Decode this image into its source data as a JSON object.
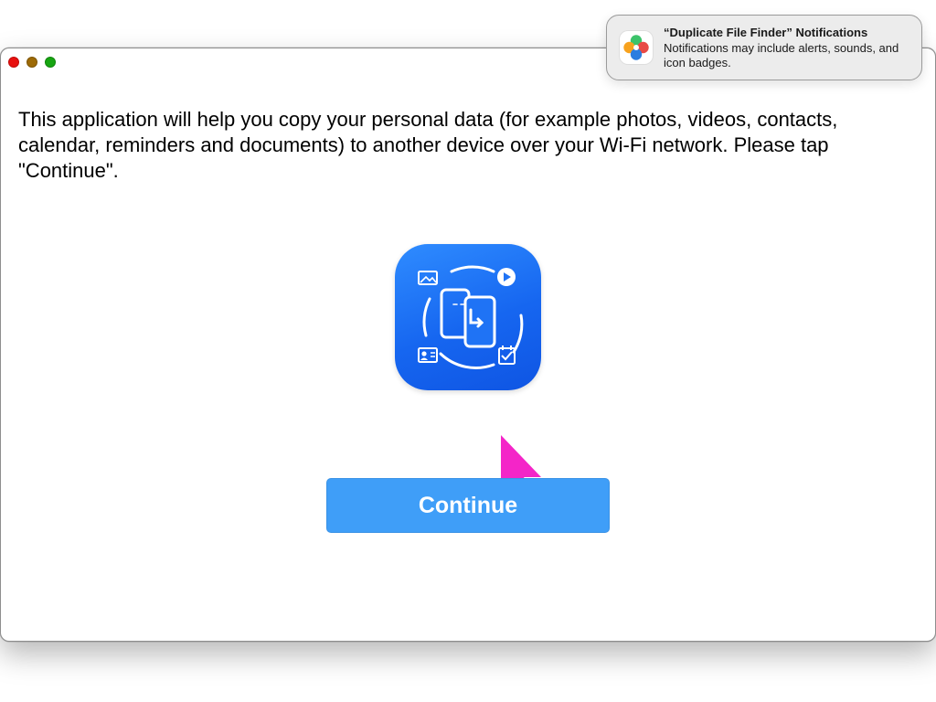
{
  "window": {
    "message": "This application will help you copy your personal data (for example photos, videos, contacts, calendar, reminders and documents) to another device over your Wi-Fi network. Please tap \"Continue\".",
    "continue_label": "Continue",
    "app_icon": "data-transfer-app-icon"
  },
  "notification": {
    "title": "“Duplicate File Finder” Notifications",
    "body": "Notifications may include alerts, sounds, and icon badges.",
    "icon": "duplicate-file-finder-icon"
  },
  "colors": {
    "button": "#3f9ef8",
    "icon_gradient_top": "#2f8cff",
    "icon_gradient_bottom": "#0f55e3",
    "cursor": "#f425c8",
    "close": "#e8100f",
    "minimize": "#9d6a06",
    "maximize": "#17a512"
  }
}
